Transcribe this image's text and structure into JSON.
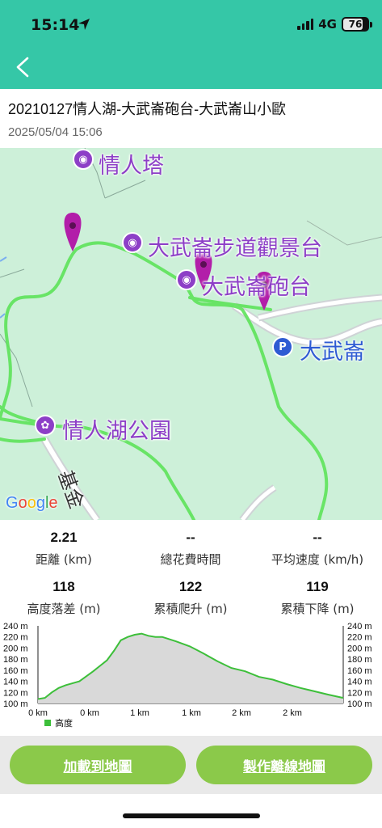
{
  "status_bar": {
    "time": "15:14",
    "network": "4G",
    "battery": "76"
  },
  "header": {
    "back_icon": "chevron-left-icon"
  },
  "route": {
    "title": "20210127情人湖-大武崙砲台-大武崙山小歐",
    "date": "2025/05/04 15:06"
  },
  "map": {
    "pois": [
      {
        "name": "情人塔",
        "icon": "camera-icon"
      },
      {
        "name": "大武崙步道觀景台",
        "icon": "camera-icon"
      },
      {
        "name": "大武崙砲台",
        "icon": "camera-icon"
      },
      {
        "name": "大武崙",
        "icon": "parking-icon"
      },
      {
        "name": "情人湖公園",
        "icon": "park-icon"
      }
    ],
    "road_label": "基金",
    "attribution": "Google",
    "colors": {
      "land": "#cdf0d9",
      "track": "#5ee35a",
      "marker": "#b21ea9",
      "poi": "#8d3fc7",
      "parking": "#2e5bd3"
    }
  },
  "stats": [
    {
      "value": "2.21",
      "label": "距離 (km)"
    },
    {
      "value": "--",
      "label": "總花費時間"
    },
    {
      "value": "--",
      "label": "平均速度 (km/h)"
    },
    {
      "value": "118",
      "label": "高度落差 (m)"
    },
    {
      "value": "122",
      "label": "累積爬升 (m)"
    },
    {
      "value": "119",
      "label": "累積下降 (m)"
    }
  ],
  "chart_data": {
    "type": "area",
    "yticks": [
      "240 m",
      "220 m",
      "200 m",
      "180 m",
      "160 m",
      "140 m",
      "120 m",
      "100 m"
    ],
    "xticks": [
      "0 km",
      "0 km",
      "1 km",
      "1 km",
      "2 km",
      "2 km"
    ],
    "ylim": [
      100,
      240
    ],
    "xlim": [
      0,
      2.21
    ],
    "legend": "高度",
    "legend_color": "#3dbf3a",
    "series": [
      {
        "name": "高度",
        "x": [
          0,
          0.05,
          0.1,
          0.15,
          0.2,
          0.3,
          0.4,
          0.5,
          0.55,
          0.6,
          0.65,
          0.7,
          0.75,
          0.8,
          0.85,
          0.9,
          1.0,
          1.1,
          1.2,
          1.3,
          1.4,
          1.5,
          1.6,
          1.7,
          1.8,
          1.9,
          2.0,
          2.1,
          2.21
        ],
        "y": [
          108,
          110,
          120,
          128,
          133,
          140,
          158,
          178,
          195,
          214,
          220,
          224,
          226,
          222,
          220,
          220,
          212,
          203,
          190,
          176,
          164,
          158,
          148,
          143,
          135,
          128,
          122,
          116,
          110
        ]
      }
    ]
  },
  "actions": {
    "load_to_map": "加載到地圖",
    "make_offline_map": "製作離線地圖"
  }
}
